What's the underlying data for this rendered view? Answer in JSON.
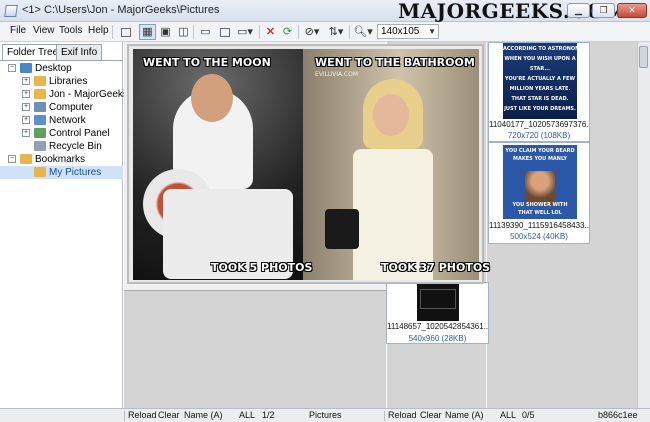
{
  "window": {
    "title": "<1> C:\\Users\\Jon - MajorGeeks\\Pictures",
    "watermark": "MAJORGEEKS.COM",
    "btn_min": "▁",
    "btn_max": "❐",
    "btn_close": "✕"
  },
  "menu": {
    "file": "File",
    "view": "View",
    "tools": "Tools",
    "help": "Help"
  },
  "toolbar": {
    "zoom_value": "140x105"
  },
  "tabs": {
    "folder_tree": "Folder Tree",
    "exif_info": "Exif Info"
  },
  "tree": [
    {
      "label": "Desktop",
      "level": 0,
      "expander": "−",
      "icon": "desktop-icon",
      "color": "#4a86c8"
    },
    {
      "label": "Libraries",
      "level": 1,
      "expander": "+",
      "icon": "library-icon",
      "color": "#e7b54a"
    },
    {
      "label": "Jon - MajorGeeks",
      "level": 1,
      "expander": "+",
      "icon": "user-folder-icon",
      "color": "#e7b54a"
    },
    {
      "label": "Computer",
      "level": 1,
      "expander": "+",
      "icon": "computer-icon",
      "color": "#6c8fb8"
    },
    {
      "label": "Network",
      "level": 1,
      "expander": "+",
      "icon": "network-icon",
      "color": "#5b8fcf"
    },
    {
      "label": "Control Panel",
      "level": 1,
      "expander": "+",
      "icon": "control-panel-icon",
      "color": "#5fa05a"
    },
    {
      "label": "Recycle Bin",
      "level": 1,
      "expander": "",
      "icon": "recycle-bin-icon",
      "color": "#8fa3b8"
    },
    {
      "label": "Bookmarks",
      "level": 0,
      "expander": "−",
      "icon": "bookmark-folder-icon",
      "color": "#e7b54a"
    },
    {
      "label": "My Pictures",
      "level": 1,
      "expander": "",
      "icon": "pictures-folder-icon",
      "color": "#e7b54a",
      "selected": true
    }
  ],
  "preview": {
    "left_top": "WENT TO THE MOON",
    "left_bottom": "TOOK 5 PHOTOS",
    "right_top": "WENT TO THE BATHROOM",
    "right_bottom": "TOOK 37 PHOTOS",
    "right_site": "EVILUVIA.COM"
  },
  "thumbnails": [
    {
      "name": "11040177_1020573697376...",
      "info": "720x720 (108KB)",
      "text": [
        "ACCORDING TO ASTRONOMY,",
        "WHEN YOU WISH UPON A",
        "STAR...",
        "YOU'RE ACTUALLY A FEW",
        "MILLION YEARS LATE.",
        "THAT STAR IS DEAD.",
        "JUST LIKE YOUR DREAMS."
      ]
    },
    {
      "name": "11139390_1115916458433...",
      "info": "500x524 (40KB)",
      "text": [
        "YOU CLAIM YOUR BEARD",
        "MAKES YOU MANLY",
        "YOU SHOWER WITH",
        "THAT WELL LOL"
      ]
    },
    {
      "name": "11148657_1020542854361...",
      "info": "540x960 (28KB)"
    }
  ],
  "status_left": {
    "reload": "Reload",
    "clear": "Clear",
    "sort": "Name (A)",
    "filter": "ALL",
    "count": "1/2",
    "folder": "Pictures"
  },
  "status_right": {
    "reload": "Reload",
    "clear": "Clear",
    "sort": "Name (A)",
    "filter": "ALL",
    "count": "0/5",
    "hash": "b866c1ee"
  }
}
